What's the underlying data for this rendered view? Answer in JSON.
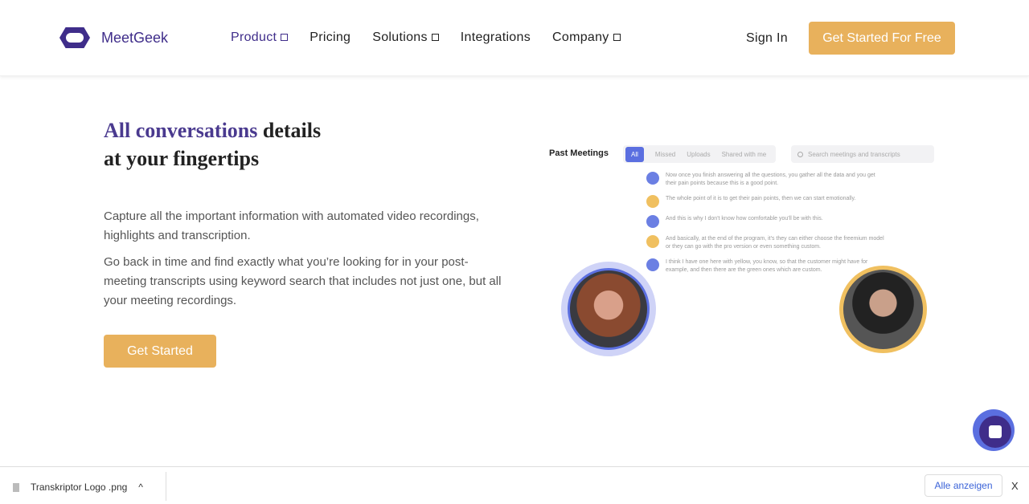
{
  "nav": {
    "brand": "MeetGeek",
    "items": [
      {
        "label": "Product",
        "dropdown": true,
        "active": true
      },
      {
        "label": "Pricing"
      },
      {
        "label": "Solutions",
        "dropdown": true
      },
      {
        "label": "Integrations"
      },
      {
        "label": "Company",
        "dropdown": true
      }
    ],
    "sign_in": "Sign In",
    "cta": "Get Started For Free"
  },
  "hero": {
    "title_highlight": "All conversations",
    "title_rest": " details",
    "title_line2": "at your fingertips",
    "para1": "Capture all the important information with automated video recordings, highlights and transcription.",
    "para2": "Go back in time and find exactly what you’re looking for in your post-meeting transcripts using keyword search that includes not just one, but all your meeting recordings.",
    "button": "Get Started"
  },
  "mockup": {
    "title": "Past Meetings",
    "tabs": [
      "All",
      "Missed",
      "Uploads",
      "Shared with me"
    ],
    "search_placeholder": "Search meetings and transcripts",
    "lines": [
      {
        "color": "#6b7fe3",
        "text": "Now once you finish answering all the questions, you gather all the data and you get their pain points because this is a good point."
      },
      {
        "color": "#f0c060",
        "text": "The whole point of it is to get their pain points, then we can start emotionally."
      },
      {
        "color": "#6b7fe3",
        "text": "And this is why I don't know how comfortable you'll be with this."
      },
      {
        "color": "#f0c060",
        "text": "And basically, at the end of the program, it's they can either choose the freemium model or they can go with the pro version or even something custom."
      },
      {
        "color": "#6b7fe3",
        "text": "I think I have one here with yellow, you know, so that the customer might have for example, and then there are the green ones which are custom."
      }
    ]
  },
  "download_bar": {
    "file": "Transkriptor Logo .png",
    "show_all": "Alle anzeigen",
    "close": "X"
  },
  "colors": {
    "brand": "#3f2d8a",
    "accent": "#e8b15c",
    "blue": "#5b6fe0"
  }
}
